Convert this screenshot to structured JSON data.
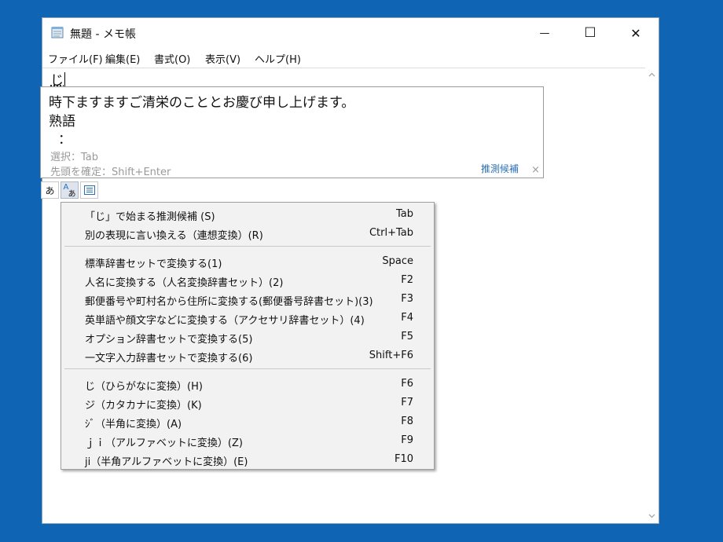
{
  "window": {
    "title": "無題 - メモ帳",
    "minimize_glyph": "—",
    "maximize_glyph": "☐",
    "close_glyph": "✕"
  },
  "menubar": {
    "items": [
      "ファイル(F)",
      "編集(E)",
      "書式(O)",
      "表示(V)",
      "ヘルプ(H)"
    ]
  },
  "editor": {
    "composing_text": "じ"
  },
  "ime_panel": {
    "candidate_1": "時下ますますご清栄のこととお慶び申し上げます。",
    "candidate_2": "熟語",
    "candidate_3": "：",
    "hint_select": "選択：Tab",
    "hint_confirm": "先頭を確定：Shift+Enter",
    "prediction_link": "推測候補",
    "close_glyph": "×"
  },
  "ime_toolbar": {
    "btn1": "あ",
    "btn2": "A",
    "btn2_sub": "あ"
  },
  "context_menu": {
    "group1": [
      {
        "label": "「じ」で始まる推測候補 (S)",
        "shortcut": "Tab"
      },
      {
        "label": "別の表現に言い換える（連想変換）(R)",
        "shortcut": "Ctrl+Tab"
      }
    ],
    "group2": [
      {
        "label": "標準辞書セットで変換する(1)",
        "shortcut": "Space"
      },
      {
        "label": "人名に変換する（人名変換辞書セット）(2)",
        "shortcut": "F2"
      },
      {
        "label": "郵便番号や町村名から住所に変換する(郵便番号辞書セット)(3)",
        "shortcut": "F3"
      },
      {
        "label": "英単語や顔文字などに変換する（アクセサリ辞書セット）(4)",
        "shortcut": "F4"
      },
      {
        "label": "オプション辞書セットで変換する(5)",
        "shortcut": "F5"
      },
      {
        "label": "一文字入力辞書セットで変換する(6)",
        "shortcut": "Shift+F6"
      }
    ],
    "group3": [
      {
        "label": "じ（ひらがなに変換）(H)",
        "shortcut": "F6"
      },
      {
        "label": "ジ（カタカナに変換）(K)",
        "shortcut": "F7"
      },
      {
        "label": "ｼﾞ（半角に変換）(A)",
        "shortcut": "F8"
      },
      {
        "label": "ｊｉ（アルファベットに変換）(Z)",
        "shortcut": "F9"
      },
      {
        "label": "ji（半角アルファベットに変換）(E)",
        "shortcut": "F10"
      }
    ]
  },
  "colors": {
    "desktop": "#0f64b4",
    "menu_bg": "#f2f2f2",
    "link": "#2a6fb5"
  }
}
